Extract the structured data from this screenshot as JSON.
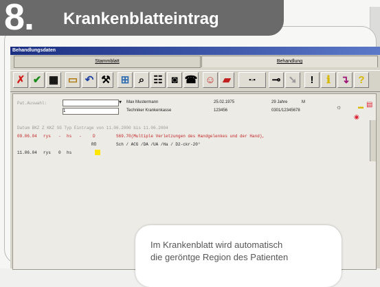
{
  "header": {
    "step_number": "8.",
    "title": "Krankenblatteintrag"
  },
  "window": {
    "title": "Behandlungsdaten"
  },
  "tabs": [
    {
      "label": "Stammblatt"
    },
    {
      "label": "Behandlung"
    }
  ],
  "patient": {
    "label": "Pat.Auswahl:",
    "field_value": "1",
    "name": "Max Mustermann",
    "insurance": "Techniker Krankenkasse",
    "birth_date": "25.02.1975",
    "insurance_number": "123456",
    "age": "29 Jahre",
    "sex": "M",
    "case_number": "0301/12345678"
  },
  "table_header": "Datum  BKZ  Z  KKZ  SG  Typ   Eintrage von 11.06.2000 bis 11.06.2004",
  "entries": [
    {
      "date": "09.06.04",
      "bkz": "rys",
      "z": "-",
      "kkz": "hs",
      "sg": "-",
      "typ": "D",
      "text": "S69.70(Multiple Verletzungen des Handgelenkes und der Hand),"
    },
    {
      "typ": "RÖ",
      "text": "Sch / ACG /DA /UA /Ha / D2-ckr-20°"
    },
    {
      "date": "11.06.04",
      "bkz": "rys",
      "z": "0",
      "kkz": "hs",
      "sg": "",
      "typ": "",
      "text": ""
    }
  ],
  "caption": {
    "line1": "Im Krankenblatt wird automatisch",
    "line2": "die geröntge Region des Patienten"
  },
  "toolbar_icons": [
    "delete-x-icon",
    "checkmark-icon",
    "calendar-icon",
    "folder-icon",
    "undo-icon",
    "tools-icon",
    "grid-icon",
    "magnify-icon",
    "people-icon",
    "camera-icon",
    "phone-icon",
    "user-icon",
    "card-icon",
    "buttons-icon",
    "key-icon",
    "arrow-icon",
    "exclamation-icon",
    "info-icon",
    "arrow-down-icon",
    "help-icon"
  ],
  "colors": {
    "accent": "#1b2f82",
    "entry_red": "#c22020",
    "tab_bg": "#6a6a6a"
  }
}
